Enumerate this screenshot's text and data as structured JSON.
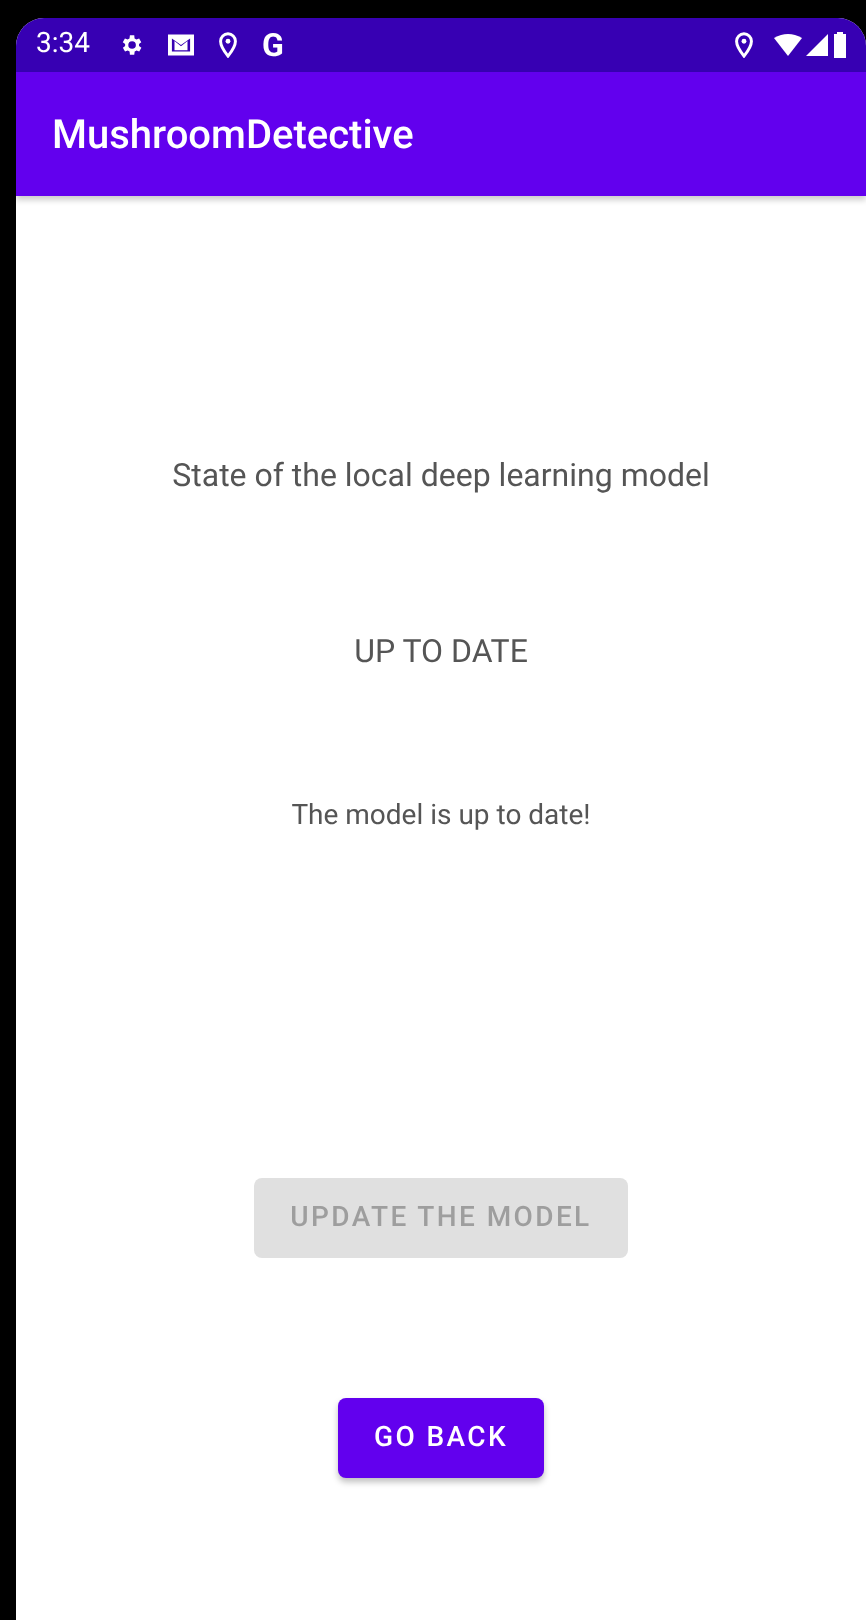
{
  "status_bar": {
    "time": "3:34",
    "notification_letter": "G"
  },
  "app_bar": {
    "title": "MushroomDetective"
  },
  "heading": "State of the local deep learning model",
  "state": "UP TO DATE",
  "message": "The model is up to date!",
  "buttons": [
    {
      "label": "UPDATE THE MODEL",
      "disabled": true
    },
    {
      "label": "GO BACK",
      "disabled": false
    }
  ]
}
